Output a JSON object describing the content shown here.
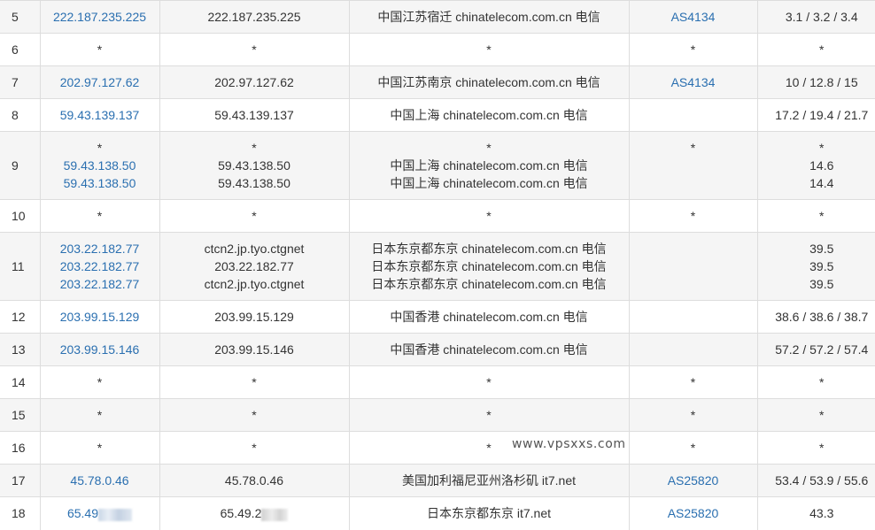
{
  "watermark": "www.vpsxxs.com",
  "colors": {
    "link": "#2a6fb0",
    "row_alt": "#f5f5f5",
    "border": "#dddddd"
  },
  "rows": [
    {
      "hop": "5",
      "ips": [
        "222.187.235.225"
      ],
      "hosts": [
        "222.187.235.225"
      ],
      "locations": [
        "中国江苏宿迁 chinatelecom.com.cn 电信"
      ],
      "as": [
        "AS4134"
      ],
      "times": [
        "3.1 / 3.2 / 3.4"
      ]
    },
    {
      "hop": "6",
      "ips": [
        "*"
      ],
      "hosts": [
        "*"
      ],
      "locations": [
        "*"
      ],
      "as": [
        "*"
      ],
      "times": [
        "*"
      ]
    },
    {
      "hop": "7",
      "ips": [
        "202.97.127.62"
      ],
      "hosts": [
        "202.97.127.62"
      ],
      "locations": [
        "中国江苏南京 chinatelecom.com.cn 电信"
      ],
      "as": [
        "AS4134"
      ],
      "times": [
        "10 / 12.8 / 15"
      ]
    },
    {
      "hop": "8",
      "ips": [
        "59.43.139.137"
      ],
      "hosts": [
        "59.43.139.137"
      ],
      "locations": [
        "中国上海 chinatelecom.com.cn 电信"
      ],
      "as": [
        ""
      ],
      "times": [
        "17.2 / 19.4 / 21.7"
      ]
    },
    {
      "hop": "9",
      "ips": [
        "*",
        "59.43.138.50",
        "59.43.138.50"
      ],
      "hosts": [
        "*",
        "59.43.138.50",
        "59.43.138.50"
      ],
      "locations": [
        "*",
        "中国上海 chinatelecom.com.cn 电信",
        "中国上海 chinatelecom.com.cn 电信"
      ],
      "as": [
        "*",
        "",
        ""
      ],
      "times": [
        "*",
        "14.6",
        "14.4"
      ]
    },
    {
      "hop": "10",
      "ips": [
        "*"
      ],
      "hosts": [
        "*"
      ],
      "locations": [
        "*"
      ],
      "as": [
        "*"
      ],
      "times": [
        "*"
      ]
    },
    {
      "hop": "11",
      "ips": [
        "203.22.182.77",
        "203.22.182.77",
        "203.22.182.77"
      ],
      "hosts": [
        "ctcn2.jp.tyo.ctgnet",
        "203.22.182.77",
        "ctcn2.jp.tyo.ctgnet"
      ],
      "locations": [
        "日本东京都东京 chinatelecom.com.cn 电信",
        "日本东京都东京 chinatelecom.com.cn 电信",
        "日本东京都东京 chinatelecom.com.cn 电信"
      ],
      "as": [
        "",
        "",
        ""
      ],
      "times": [
        "39.5",
        "39.5",
        "39.5"
      ]
    },
    {
      "hop": "12",
      "ips": [
        "203.99.15.129"
      ],
      "hosts": [
        "203.99.15.129"
      ],
      "locations": [
        "中国香港 chinatelecom.com.cn 电信"
      ],
      "as": [
        ""
      ],
      "times": [
        "38.6 / 38.6 / 38.7"
      ]
    },
    {
      "hop": "13",
      "ips": [
        "203.99.15.146"
      ],
      "hosts": [
        "203.99.15.146"
      ],
      "locations": [
        "中国香港 chinatelecom.com.cn 电信"
      ],
      "as": [
        ""
      ],
      "times": [
        "57.2 / 57.2 / 57.4"
      ]
    },
    {
      "hop": "14",
      "ips": [
        "*"
      ],
      "hosts": [
        "*"
      ],
      "locations": [
        "*"
      ],
      "as": [
        "*"
      ],
      "times": [
        "*"
      ]
    },
    {
      "hop": "15",
      "ips": [
        "*"
      ],
      "hosts": [
        "*"
      ],
      "locations": [
        "*"
      ],
      "as": [
        "*"
      ],
      "times": [
        "*"
      ]
    },
    {
      "hop": "16",
      "ips": [
        "*"
      ],
      "hosts": [
        "*"
      ],
      "locations": [
        "*"
      ],
      "as": [
        "*"
      ],
      "times": [
        "*"
      ]
    },
    {
      "hop": "17",
      "ips": [
        "45.78.0.46"
      ],
      "hosts": [
        "45.78.0.46"
      ],
      "locations": [
        "美国加利福尼亚州洛杉矶 it7.net"
      ],
      "as": [
        "AS25820"
      ],
      "times": [
        "53.4 / 53.9 / 55.6"
      ]
    },
    {
      "hop": "18",
      "ips": [
        "65.49"
      ],
      "hosts": [
        "65.49.2"
      ],
      "locations": [
        "日本东京都东京 it7.net"
      ],
      "as": [
        "AS25820"
      ],
      "times": [
        "43.3"
      ]
    }
  ]
}
